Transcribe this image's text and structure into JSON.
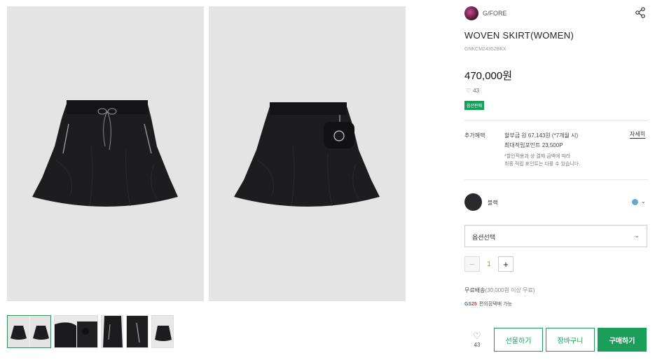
{
  "gallery": {
    "main_images": [
      "front-view",
      "back-view"
    ],
    "thumbnails": [
      "front-back",
      "detail-1",
      "detail-2",
      "detail-3"
    ]
  },
  "brand": {
    "name": "G/FORE"
  },
  "product": {
    "title": "WOVEN SKIRT(WOMEN)",
    "code": "GNKCM24352BKX",
    "price": "470,000원",
    "likes": "43",
    "tag": "옵션판매"
  },
  "benefits": {
    "label": "추가혜택",
    "line1": "할부금 원 67,143원 (*7개월 시)",
    "line2": "최대적립포인트 23,500P",
    "note1": "*할인적용과 상 결제 금액에 따라",
    "note2": "최종 적립 포인트는 다를 수 있습니다.",
    "detail_link": "자세히"
  },
  "color": {
    "name": "블랙",
    "swatch": "#2a2a2e",
    "dot": "#6aa6cc"
  },
  "option": {
    "label": "옵션선택"
  },
  "quantity": {
    "value": "1",
    "minus": "−",
    "plus": "+"
  },
  "shipping": {
    "text": "무료배송",
    "condition": "(30,000원 이상 무료)",
    "gs_logo_a": "GS",
    "gs_logo_b": "25",
    "gs_text": "편의점택배 가능"
  },
  "actions": {
    "wish_count": "43",
    "gift": "선물하기",
    "cart": "장바구니",
    "buy": "구매하기"
  },
  "colors": {
    "accent": "#1a9e5a"
  }
}
